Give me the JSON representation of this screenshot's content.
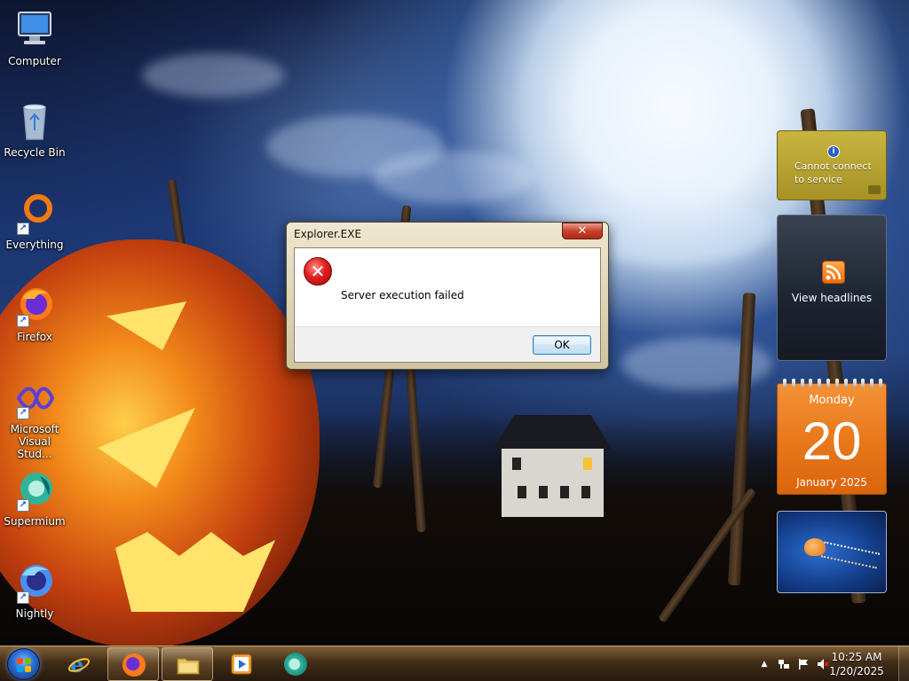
{
  "desktop": {
    "icons": [
      {
        "label": "Computer",
        "icon": "computer-icon",
        "shortcut": false
      },
      {
        "label": "Recycle Bin",
        "icon": "recycle-bin-icon",
        "shortcut": false
      },
      {
        "label": "Everything",
        "icon": "everything-icon",
        "shortcut": true
      },
      {
        "label": "Firefox",
        "icon": "firefox-icon",
        "shortcut": true
      },
      {
        "label": "Microsoft Visual Stud...",
        "icon": "visual-studio-icon",
        "shortcut": true
      },
      {
        "label": "Supermium",
        "icon": "supermium-icon",
        "shortcut": true
      },
      {
        "label": "Nightly",
        "icon": "firefox-nightly-icon",
        "shortcut": true
      }
    ]
  },
  "dialog": {
    "title": "Explorer.EXE",
    "close_glyph": "✕",
    "icon": "error-icon",
    "error_glyph": "✕",
    "message": "Server execution failed",
    "ok_label": "OK"
  },
  "gadgets": {
    "currency": {
      "message": "Cannot connect to service",
      "info_glyph": "i"
    },
    "feed": {
      "label": "View headlines",
      "icon": "rss-icon"
    },
    "calendar": {
      "weekday": "Monday",
      "day": "20",
      "month_year": "January 2025"
    },
    "slideshow": {
      "icon": "jellyfish-photo"
    }
  },
  "taskbar": {
    "pinned": [
      {
        "name": "internet-explorer",
        "icon": "internet-explorer-icon",
        "active": false
      },
      {
        "name": "firefox",
        "icon": "firefox-icon",
        "active": true
      },
      {
        "name": "windows-explorer",
        "icon": "folder-icon",
        "active": true
      },
      {
        "name": "media-player",
        "icon": "media-player-icon",
        "active": false
      },
      {
        "name": "supermium",
        "icon": "supermium-icon",
        "active": false
      }
    ],
    "tray": {
      "overflow_glyph": "▲",
      "time": "10:25 AM",
      "date": "1/20/2025"
    }
  },
  "colors": {
    "calendar_orange": "#e8761a",
    "currency_gold": "#b8a432",
    "close_red": "#c8402a",
    "ok_blue_border": "#3c7fb1"
  }
}
